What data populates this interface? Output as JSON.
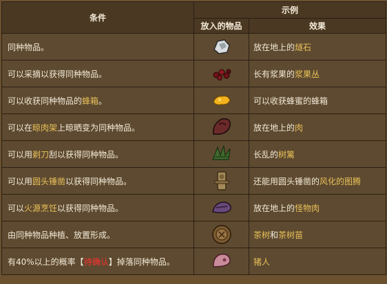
{
  "header": {
    "condition": "条件",
    "example": "示例",
    "item_placed": "放入的物品",
    "effect": "效果"
  },
  "rows": [
    {
      "cond": [
        {
          "t": "同种物品。",
          "hl": false
        }
      ],
      "icon": "flint-icon",
      "effect": [
        {
          "t": "放在地上的",
          "hl": false
        },
        {
          "t": "燧石",
          "hl": true
        }
      ]
    },
    {
      "cond": [
        {
          "t": "可以采摘以获得同种物品。",
          "hl": false
        }
      ],
      "icon": "berries-icon",
      "effect": [
        {
          "t": "长有浆果的",
          "hl": false
        },
        {
          "t": "浆果丛",
          "hl": true
        }
      ]
    },
    {
      "cond": [
        {
          "t": "可以收获同种物品的",
          "hl": false
        },
        {
          "t": "蜂箱",
          "hl": true
        },
        {
          "t": "。",
          "hl": false
        }
      ],
      "icon": "honey-icon",
      "effect": [
        {
          "t": "可以收获蜂蜜的蜂箱",
          "hl": false
        }
      ]
    },
    {
      "cond": [
        {
          "t": "可以在",
          "hl": false
        },
        {
          "t": "晾肉架",
          "hl": true
        },
        {
          "t": "上晾晒变为同种物品。",
          "hl": false
        }
      ],
      "icon": "meat-icon",
      "effect": [
        {
          "t": "放在地上的",
          "hl": false
        },
        {
          "t": "肉",
          "hl": true
        }
      ]
    },
    {
      "cond": [
        {
          "t": "可以用",
          "hl": false
        },
        {
          "t": "剃刀",
          "hl": true
        },
        {
          "t": "刮以获得同种物品。",
          "hl": false
        }
      ],
      "icon": "tumbleweed-icon",
      "effect": [
        {
          "t": "长乱的",
          "hl": false
        },
        {
          "t": "树篱",
          "hl": true
        }
      ]
    },
    {
      "cond": [
        {
          "t": "可以用",
          "hl": false
        },
        {
          "t": "圆头锤凿",
          "hl": true
        },
        {
          "t": "以获得同种物品。",
          "hl": false
        }
      ],
      "icon": "totem-icon",
      "effect": [
        {
          "t": "还能用圆头锤凿的",
          "hl": false
        },
        {
          "t": "风化的图腾",
          "hl": true
        }
      ]
    },
    {
      "cond": [
        {
          "t": "可以",
          "hl": false
        },
        {
          "t": "火源烹饪",
          "hl": true
        },
        {
          "t": "以获得同种物品。",
          "hl": false
        }
      ],
      "icon": "monster-meat-icon",
      "effect": [
        {
          "t": "放在地上的",
          "hl": false
        },
        {
          "t": "怪物肉",
          "hl": true
        }
      ]
    },
    {
      "cond": [
        {
          "t": "由同种物品种植、放置形成。",
          "hl": false
        }
      ],
      "icon": "tea-tree-icon",
      "effect": [
        {
          "t": "茶树",
          "hl": true
        },
        {
          "t": "和",
          "hl": false
        },
        {
          "t": "茶树苗",
          "hl": true
        }
      ]
    },
    {
      "cond": [
        {
          "t": "有40%以上的概率【",
          "hl": false
        },
        {
          "t": "待确认",
          "hl": "tag"
        },
        {
          "t": "】掉落同种物品。",
          "hl": false
        }
      ],
      "icon": "pig-skin-icon",
      "effect": [
        {
          "t": "猪人",
          "hl": true
        }
      ]
    }
  ],
  "colors": {
    "background": "#6b5130",
    "cell": "#5e4a30",
    "header": "#4a3822",
    "highlight": "#e8c15a",
    "tag": "#ff3030"
  }
}
